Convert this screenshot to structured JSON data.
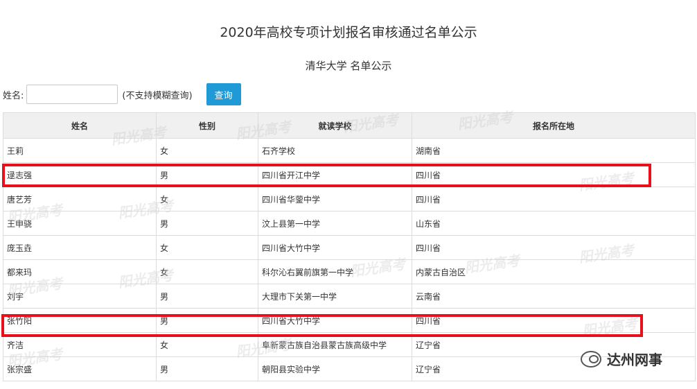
{
  "header": {
    "title": "2020年高校专项计划报名审核通过名单公示",
    "subtitle": "清华大学 名单公示"
  },
  "search": {
    "label": "姓名:",
    "placeholder": "",
    "value": "",
    "note": "(不支持模糊查询)",
    "button_label": "查询"
  },
  "table": {
    "headers": [
      "姓名",
      "性别",
      "就读学校",
      "报名所在地"
    ],
    "rows": [
      [
        "王莉",
        "女",
        "石齐学校",
        "湖南省"
      ],
      [
        "逯志强",
        "男",
        "四川省开江中学",
        "四川省"
      ],
      [
        "唐艺芳",
        "女",
        "四川省华蓥中学",
        "四川省"
      ],
      [
        "王申骁",
        "男",
        "汶上县第一中学",
        "山东省"
      ],
      [
        "庞玉垚",
        "女",
        "四川省大竹中学",
        "四川省"
      ],
      [
        "都来玛",
        "女",
        "科尔沁右翼前旗第一中学",
        "内蒙古自治区"
      ],
      [
        "刘宇",
        "男",
        "大理市下关第一中学",
        "云南省"
      ],
      [
        "张竹阳",
        "男",
        "四川省大竹中学",
        "四川省"
      ],
      [
        "齐洁",
        "女",
        "阜新蒙古族自治县蒙古族高级中学",
        "辽宁省"
      ],
      [
        "张宗盛",
        "男",
        "朝阳县实验中学",
        "辽宁省"
      ]
    ],
    "highlighted_rows": [
      1,
      7
    ]
  },
  "watermark": {
    "text": "阳光高考"
  },
  "brand": {
    "icon": "wechat-icon",
    "name": "达州网事"
  },
  "colors": {
    "button_bg": "#1f9ad6",
    "highlight_border": "#e8101b",
    "header_bg": "#f0f0f0"
  }
}
